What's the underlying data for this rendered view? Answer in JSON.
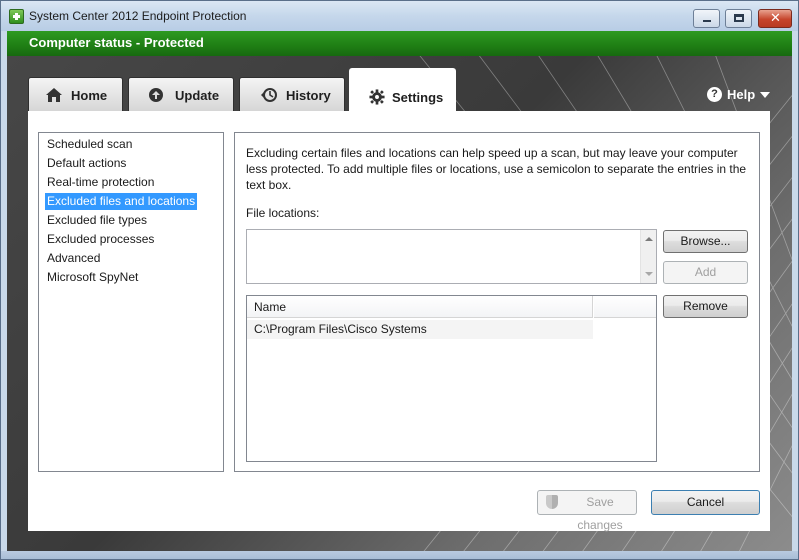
{
  "window": {
    "title": "System Center 2012 Endpoint Protection",
    "controls": {
      "minimize": "minimize",
      "maximize": "maximize",
      "close": "close"
    }
  },
  "status": {
    "text": "Computer status - Protected",
    "color": "#1f7e14"
  },
  "tabs": [
    {
      "label": "Home",
      "icon": "home-icon"
    },
    {
      "label": "Update",
      "icon": "update-icon"
    },
    {
      "label": "History",
      "icon": "history-icon"
    },
    {
      "label": "Settings",
      "icon": "gear-icon",
      "active": true
    }
  ],
  "help": {
    "label": "Help"
  },
  "sidebar": {
    "items": [
      {
        "label": "Scheduled scan"
      },
      {
        "label": "Default actions"
      },
      {
        "label": "Real-time protection"
      },
      {
        "label": "Excluded files and locations",
        "selected": true
      },
      {
        "label": "Excluded file types"
      },
      {
        "label": "Excluded processes"
      },
      {
        "label": "Advanced"
      },
      {
        "label": "Microsoft SpyNet"
      }
    ]
  },
  "main": {
    "description": "Excluding certain files and locations can help speed up a scan, but may leave your computer less protected. To add multiple files or locations, use a semicolon to separate the entries in the text box.",
    "file_locations_label": "File locations:",
    "file_locations_value": "",
    "buttons": {
      "browse": "Browse...",
      "add": "Add",
      "remove": "Remove"
    },
    "table": {
      "columns": [
        "Name"
      ],
      "rows": [
        {
          "name": "C:\\Program Files\\Cisco Systems"
        }
      ]
    }
  },
  "footer": {
    "save": "Save changes",
    "cancel": "Cancel"
  },
  "colors": {
    "selection": "#3399ff",
    "status_band": "#1f7e14"
  }
}
